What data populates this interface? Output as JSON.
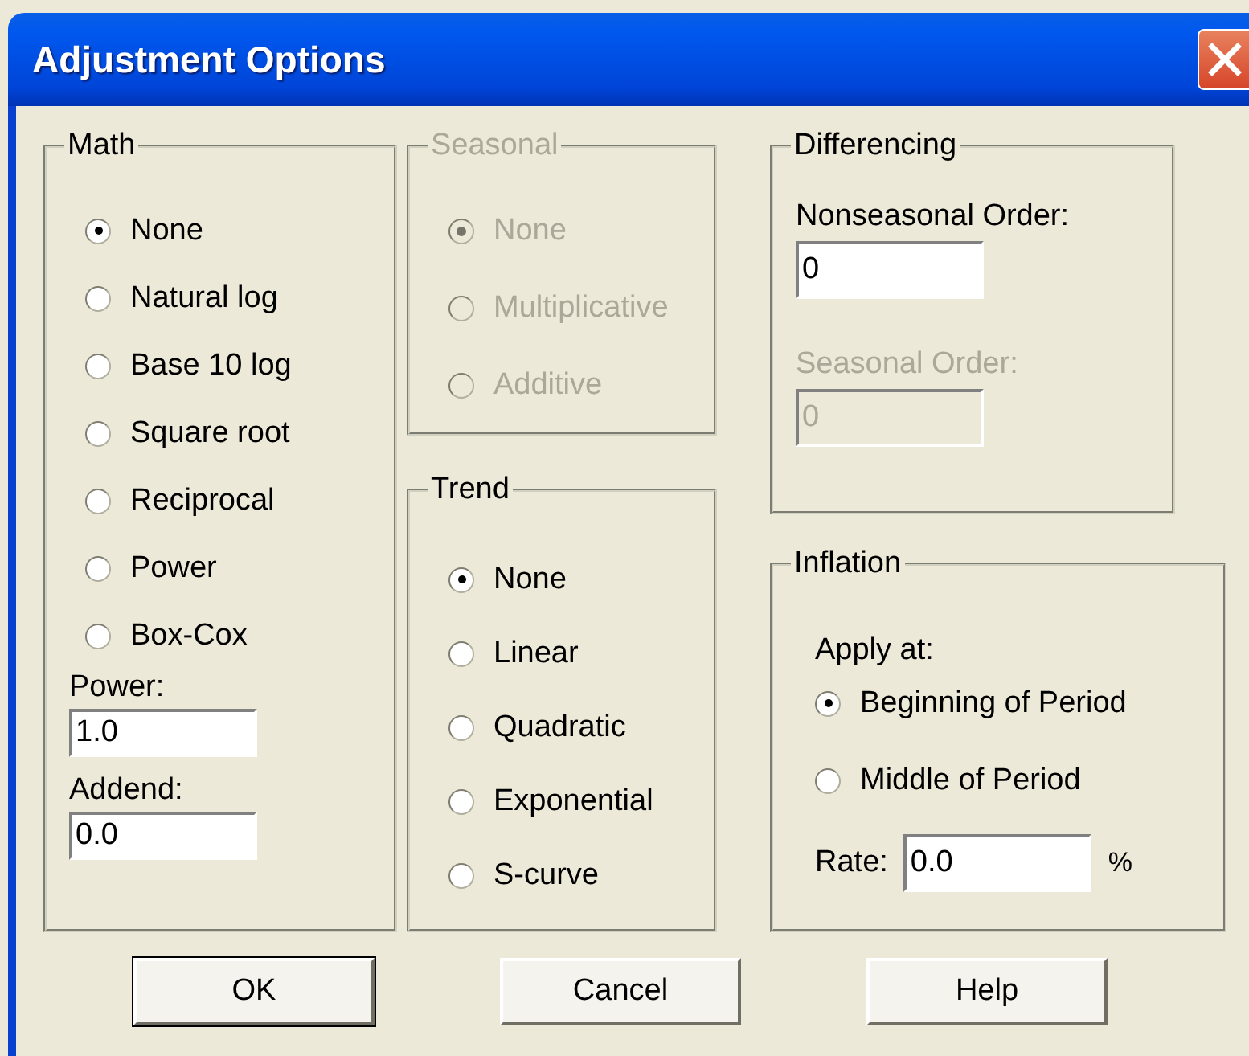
{
  "window": {
    "title": "Adjustment Options"
  },
  "math": {
    "label": "Math",
    "options": [
      {
        "label": "None",
        "selected": true
      },
      {
        "label": "Natural log",
        "selected": false
      },
      {
        "label": "Base 10 log",
        "selected": false
      },
      {
        "label": "Square root",
        "selected": false
      },
      {
        "label": "Reciprocal",
        "selected": false
      },
      {
        "label": "Power",
        "selected": false
      },
      {
        "label": "Box-Cox",
        "selected": false
      }
    ],
    "fields": [
      {
        "label": "Power:",
        "value": "1.0",
        "disabled": false
      },
      {
        "label": "Addend:",
        "value": "0.0",
        "disabled": false
      }
    ]
  },
  "seasonal": {
    "label": "Seasonal",
    "disabled": true,
    "options": [
      {
        "label": "None",
        "selected": true
      },
      {
        "label": "Multiplicative",
        "selected": false
      },
      {
        "label": "Additive",
        "selected": false
      }
    ]
  },
  "trend": {
    "label": "Trend",
    "options": [
      {
        "label": "None",
        "selected": true
      },
      {
        "label": "Linear",
        "selected": false
      },
      {
        "label": "Quadratic",
        "selected": false
      },
      {
        "label": "Exponential",
        "selected": false
      },
      {
        "label": "S-curve",
        "selected": false
      }
    ]
  },
  "differencing": {
    "label": "Differencing",
    "fields": [
      {
        "label": "Nonseasonal Order:",
        "value": "0",
        "disabled": false
      },
      {
        "label": "Seasonal Order:",
        "value": "0",
        "disabled": true
      }
    ]
  },
  "inflation": {
    "label": "Inflation",
    "apply_label": "Apply at:",
    "options": [
      {
        "label": "Beginning of Period",
        "selected": true
      },
      {
        "label": "Middle of Period",
        "selected": false
      }
    ],
    "rate_label": "Rate:",
    "rate_value": "0.0",
    "unit": "%"
  },
  "buttons": [
    {
      "label": "OK",
      "default": true
    },
    {
      "label": "Cancel",
      "default": false
    },
    {
      "label": "Help",
      "default": false
    }
  ]
}
